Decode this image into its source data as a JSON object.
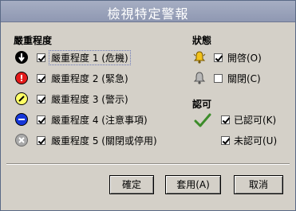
{
  "window": {
    "title": "檢視特定警報"
  },
  "severity": {
    "heading": "嚴重程度",
    "items": [
      {
        "label": "嚴重程度 1 (危機)",
        "checked": true,
        "icon": "critical-down-arrow-icon",
        "color": "#000000"
      },
      {
        "label": "嚴重程度 2 (緊急)",
        "checked": true,
        "icon": "major-exclamation-icon",
        "color": "#e41b1b"
      },
      {
        "label": "嚴重程度 3 (警示)",
        "checked": true,
        "icon": "minor-slash-icon",
        "color": "#ffff66"
      },
      {
        "label": "嚴重程度 4 (注意事項)",
        "checked": true,
        "icon": "info-minus-icon",
        "color": "#1536d8"
      },
      {
        "label": "嚴重程度 5 (關閉或停用)",
        "checked": true,
        "icon": "disabled-x-icon",
        "color": "#a9a9a9"
      }
    ]
  },
  "state": {
    "heading": "狀態",
    "items": [
      {
        "label": "開啓(O)",
        "checked": true,
        "icon": "bell-open-icon",
        "color": "#f2c21b"
      },
      {
        "label": "關閉(C)",
        "checked": false,
        "icon": "bell-closed-icon",
        "color": "#9a9a9a"
      }
    ]
  },
  "ack": {
    "heading": "認可",
    "icon": "checkmark-icon",
    "items": [
      {
        "label": "已認可(K)",
        "checked": true
      },
      {
        "label": "未認可(U)",
        "checked": true
      }
    ]
  },
  "buttons": {
    "ok": "確定",
    "apply": "套用(A)",
    "cancel": "取消"
  }
}
